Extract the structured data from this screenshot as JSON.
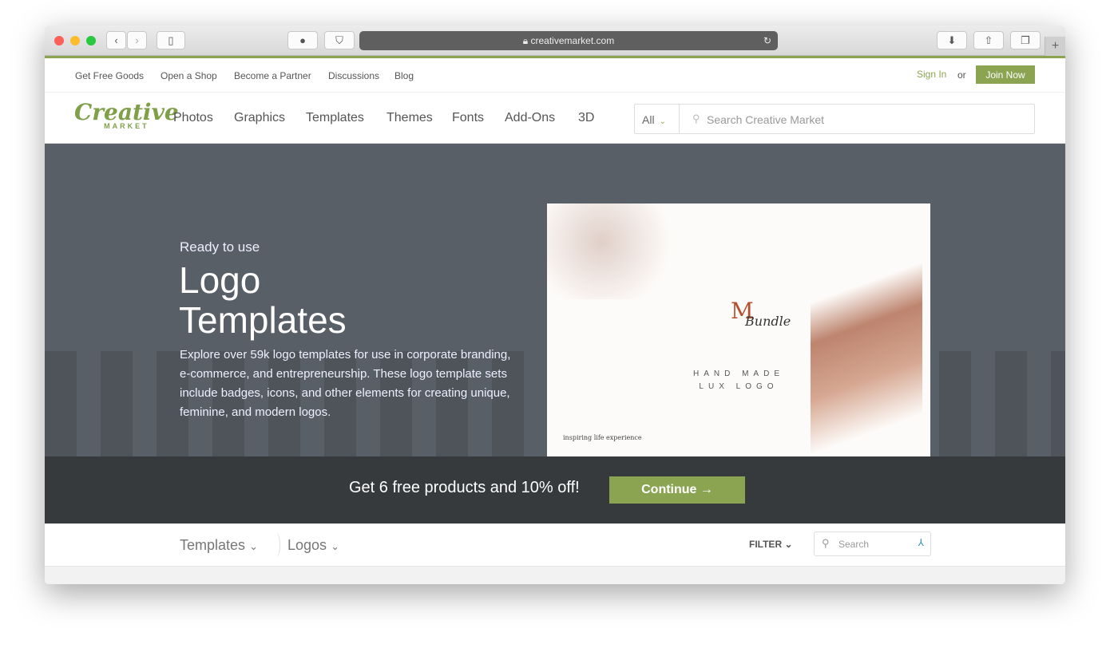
{
  "browser": {
    "url": "creativemarket.com",
    "colors": {
      "close": "#fc5f57",
      "minimize": "#fdbc2e",
      "maximize": "#28c840"
    }
  },
  "top_links": [
    "Get Free Goods",
    "Open a Shop",
    "Become a Partner",
    "Discussions",
    "Blog"
  ],
  "auth": {
    "sign_in": "Sign In",
    "or": "or",
    "join": "Join Now"
  },
  "logo": {
    "word": "Creative",
    "sub": "MARKET"
  },
  "nav": [
    "Photos",
    "Graphics",
    "Templates",
    "Themes",
    "Fonts",
    "Add-Ons",
    "3D"
  ],
  "search": {
    "category": "All",
    "placeholder": "Search Creative Market"
  },
  "hero": {
    "subtitle": "Ready to use",
    "title_line1": "Logo",
    "title_line2": "Templates",
    "description": "Explore over 59k logo templates for use in corporate branding, e-commerce, and entrepreneurship. These logo template sets include badges, icons, and other elements for creating unique, feminine, and modern logos.",
    "image": {
      "monogram": "M",
      "script": "Bundle",
      "line1": "HAND MADE",
      "line2": "LUX LOGO",
      "tagline": "inspiring life experience"
    }
  },
  "banner": {
    "text": "Get 6 free products and 10% off!",
    "button": "Continue →"
  },
  "filter_bar": {
    "crumb1": "Templates",
    "crumb2": "Logos",
    "filter": "FILTER",
    "search_placeholder": "Search"
  },
  "colors": {
    "accent": "#8ba452",
    "hero_bg": "#595f67",
    "banner_bg": "#363a3d"
  }
}
